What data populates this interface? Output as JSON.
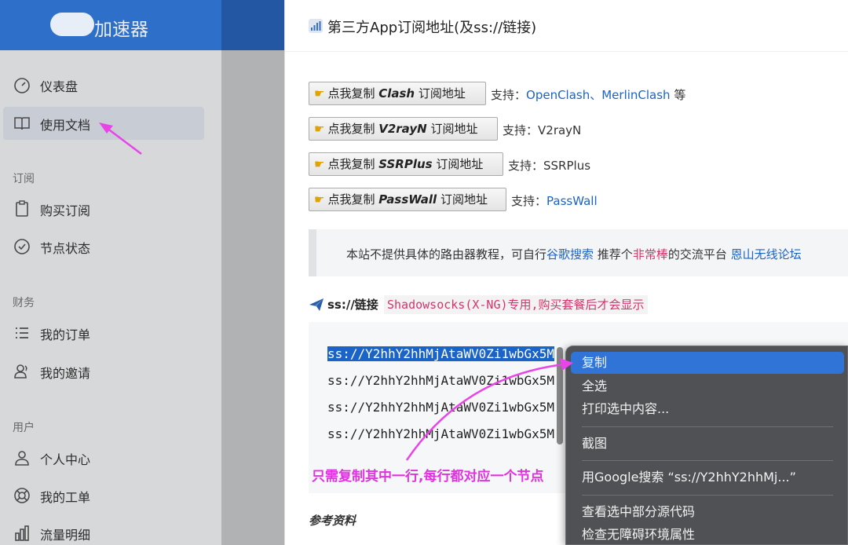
{
  "brand": {
    "name": "加速器"
  },
  "sidebar": {
    "items_top": [
      {
        "label": "仪表盘",
        "icon": "gauge-icon"
      },
      {
        "label": "使用文档",
        "icon": "book-icon"
      }
    ],
    "section_subscribe": "订阅",
    "items_subscribe": [
      {
        "label": "购买订阅",
        "icon": "clipboard-icon"
      },
      {
        "label": "节点状态",
        "icon": "check-circle-icon"
      }
    ],
    "section_finance": "财务",
    "items_finance": [
      {
        "label": "我的订单",
        "icon": "list-icon"
      },
      {
        "label": "我的邀请",
        "icon": "users-icon"
      }
    ],
    "section_user": "用户",
    "items_user": [
      {
        "label": "个人中心",
        "icon": "user-icon"
      },
      {
        "label": "我的工单",
        "icon": "lifebuoy-icon"
      },
      {
        "label": "流量明细",
        "icon": "bar-chart-icon"
      }
    ]
  },
  "panel": {
    "title": "第三方App订阅地址(及ss://链接)",
    "copy_rows": [
      {
        "prefix": "点我复制 ",
        "bold": "Clash",
        "suffix": " 订阅地址",
        "support_label": "支持：",
        "support_links": "OpenClash、MerlinClash",
        "support_tail": " 等"
      },
      {
        "prefix": "点我复制 ",
        "bold": "V2rayN",
        "suffix": " 订阅地址",
        "support_label": "支持：",
        "support_text": "V2rayN"
      },
      {
        "prefix": "点我复制 ",
        "bold": "SSRPlus",
        "suffix": " 订阅地址",
        "support_label": "支持：",
        "support_text": "SSRPlus"
      },
      {
        "prefix": "点我复制 ",
        "bold": "PassWall",
        "suffix": " 订阅地址",
        "support_label": "支持：",
        "support_links": "PassWall"
      }
    ],
    "note": {
      "part1": "本站不提供具体的路由器教程，可自行",
      "link1": "谷歌搜索",
      "part2": " 推荐个",
      "highlight": "非常棒",
      "part3": "的交流平台 ",
      "link2": "恩山无线论坛"
    },
    "ss_title": "ss://链接",
    "ss_tag": "Shadowsocks(X-NG)专用,购买套餐后才会显示",
    "code_lines": [
      "ss://Y2hhY2hhMjAtaWV0Zi1wbGx5M",
      "ss://Y2hhY2hhMjAtaWV0Zi1wbGx5M",
      "ss://Y2hhY2hhMjAtaWV0Zi1wbGx5M",
      "ss://Y2hhY2hhMjAtaWV0Zi1wbGx5M"
    ],
    "annotation": "只需复制其中一行,每行都对应一个节点",
    "ref_title": "参考资料"
  },
  "context_menu": {
    "items": [
      "复制",
      "全选",
      "打印选中内容...",
      "截图",
      "用Google搜索 “ss://Y2hhY2hhMj...”",
      "查看选中部分源代码",
      "检查无障碍环境属性"
    ]
  },
  "colors": {
    "brand": "#2e6fc9",
    "link": "#1a63c7",
    "accent_pink": "#e033e0",
    "menu_bg": "#505154",
    "menu_hover": "#2f74d6"
  }
}
